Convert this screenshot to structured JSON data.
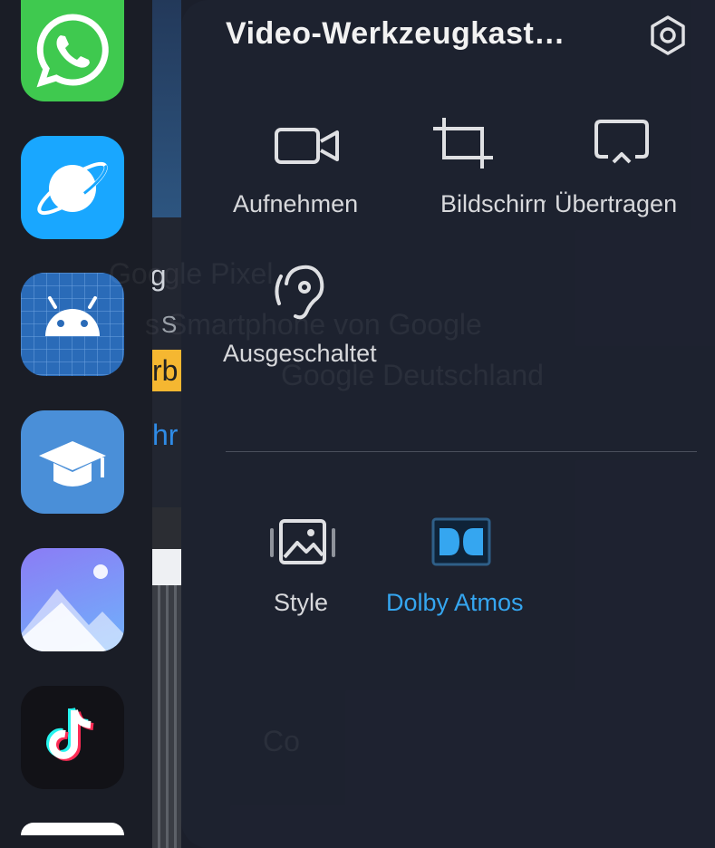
{
  "dock": {
    "apps": [
      {
        "name": "whatsapp"
      },
      {
        "name": "browser"
      },
      {
        "name": "android"
      },
      {
        "name": "education"
      },
      {
        "name": "gallery"
      },
      {
        "name": "tiktok"
      }
    ]
  },
  "background": {
    "ad_headline": "Google Pixel",
    "ad_sub": "s Smartphone von Google",
    "ad_badge": "Werbung",
    "ad_advertiser": "Google Deutschland",
    "ad_link": "hr",
    "behind_text": "Co"
  },
  "panel": {
    "title": "Video-Werkzeugkast…",
    "settings_icon": "gear-icon",
    "tools_row1": [
      {
        "label": "Aufnehmen",
        "icon": "video-camera-icon"
      },
      {
        "label": "Bildschirm",
        "icon": "crop-icon"
      },
      {
        "label": "Übertragen",
        "icon": "cast-icon"
      }
    ],
    "tools_row2": [
      {
        "label": "Ausgeschaltet",
        "icon": "ear-icon"
      }
    ],
    "tools_row3": [
      {
        "label": "Style",
        "icon": "image-style-icon"
      },
      {
        "label": "Dolby Atmos",
        "icon": "dolby-icon",
        "active": true
      }
    ],
    "colors": {
      "accent": "#35a6f0",
      "panel_bg": "#1e2230",
      "text": "#d8d9dc"
    }
  }
}
